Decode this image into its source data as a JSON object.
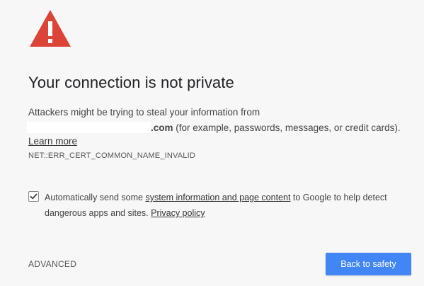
{
  "colors": {
    "warning_red": "#db4437",
    "primary_blue": "#4285f4",
    "background": "#f7f7f7"
  },
  "icon": {
    "name": "warning-triangle-icon"
  },
  "heading": {
    "title": "Your connection is not private"
  },
  "explanation": {
    "line1": "Attackers might be trying to steal your information from",
    "domain_suffix": ".com",
    "line2_rest": " (for example, passwords, messages, or credit cards)."
  },
  "learn_more": {
    "label": "Learn more"
  },
  "error_code": {
    "text": "NET::ERR_CERT_COMMON_NAME_INVALID"
  },
  "optin": {
    "checked": true,
    "text_before": "Automatically send some ",
    "link_system_info": "system information and page content",
    "text_after": " to Google to help detect dangerous apps and sites. ",
    "link_privacy": "Privacy policy"
  },
  "actions": {
    "advanced_label": "ADVANCED",
    "back_label": "Back to safety"
  }
}
